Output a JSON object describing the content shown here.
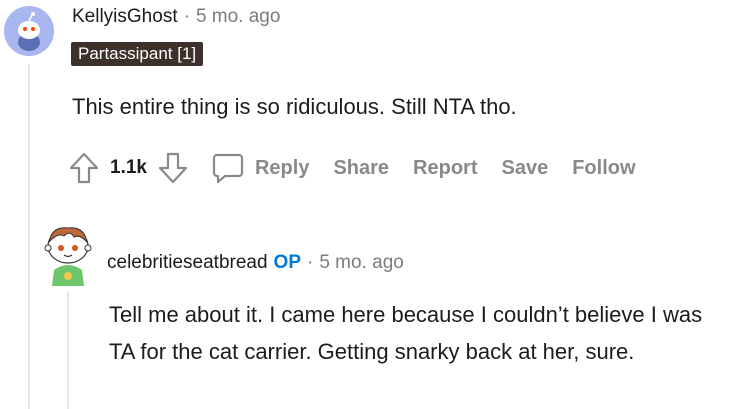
{
  "comment": {
    "author": "KellyisGhost",
    "separator": "·",
    "age": "5 mo. ago",
    "flair": "Partassipant [1]",
    "body": "This entire thing is so ridiculous. Still NTA tho.",
    "vote_count": "1.1k",
    "actions": {
      "reply": "Reply",
      "share": "Share",
      "report": "Report",
      "save": "Save",
      "follow": "Follow"
    },
    "avatar_icon": "reddit-snoo-avatar-icon",
    "avatar_color": "#a9b7f0"
  },
  "reply": {
    "author": "celebritieseatbread",
    "op_tag": "OP",
    "separator": "·",
    "age": "5 mo. ago",
    "body": "Tell me about it. I came here because I couldn’t believe I was TA for the cat carrier. Getting snarky back at her, sure.",
    "avatar_icon": "custom-snoo-avatar-icon",
    "op_color": "#0079d3"
  },
  "icons": {
    "upvote": "upvote-arrow-icon",
    "downvote": "downvote-arrow-icon",
    "reply": "speech-bubble-icon"
  }
}
